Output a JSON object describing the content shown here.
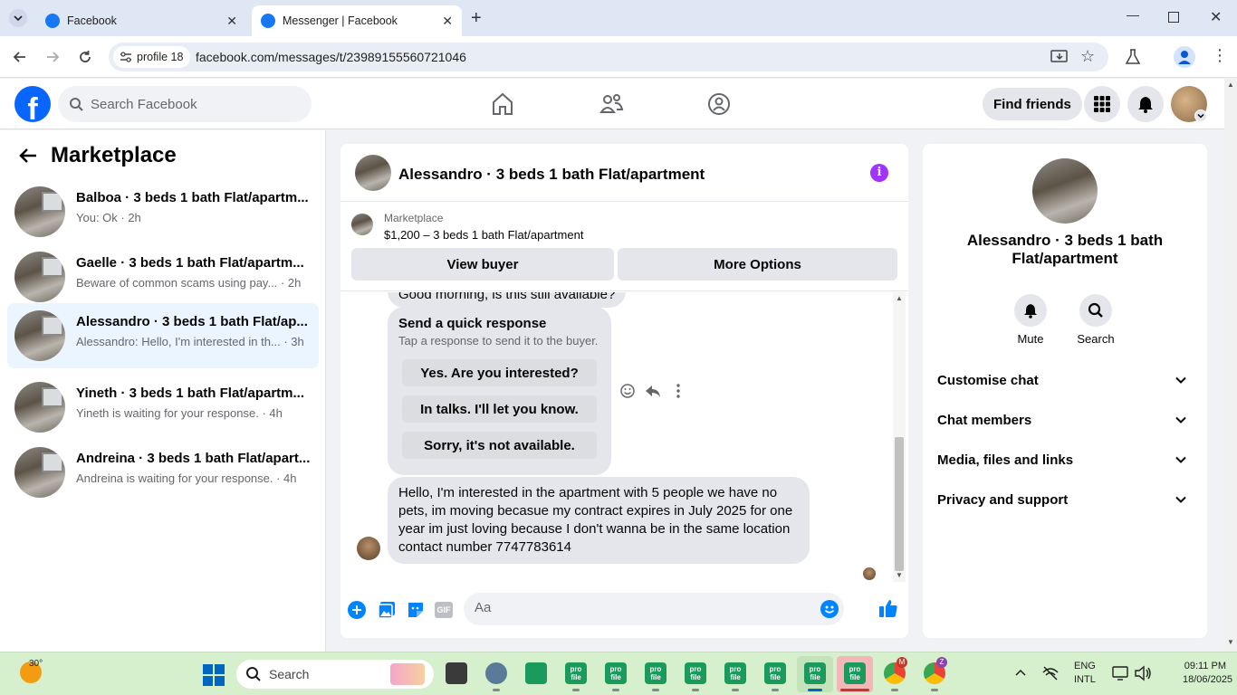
{
  "browser": {
    "tabs": [
      {
        "title": "Facebook"
      },
      {
        "title": "Messenger | Facebook"
      }
    ],
    "profile_chip": "profile 18",
    "url": "facebook.com/messages/t/23989155560721046"
  },
  "fb_header": {
    "logo": "f",
    "search_placeholder": "Search Facebook",
    "find_friends_label": "Find friends"
  },
  "marketplace": {
    "title": "Marketplace",
    "conversations": [
      {
        "name": "Balboa · 3 beds 1 bath Flat/apartm...",
        "preview": "You: Ok · 2h"
      },
      {
        "name": "Gaelle · 3 beds 1 bath Flat/apartm...",
        "preview": "Beware of common scams using pay... · 2h"
      },
      {
        "name": "Alessandro · 3 beds 1 bath Flat/ap...",
        "preview": "Alessandro: Hello, I'm interested in th... · 3h"
      },
      {
        "name": "Yineth · 3 beds 1 bath Flat/apartm...",
        "preview": "Yineth is waiting for your response. · 4h"
      },
      {
        "name": "Andreina · 3 beds 1 bath Flat/apart...",
        "preview": "Andreina is waiting for your response. · 4h"
      }
    ]
  },
  "chat": {
    "title": "Alessandro · 3 beds 1 bath Flat/apartment",
    "info_icon": "i",
    "listing": {
      "label": "Marketplace",
      "price_title": "$1,200 – 3 beds 1 bath Flat/apartment",
      "view_buyer": "View buyer",
      "more_options": "More Options"
    },
    "partial_message": "Good morning, is this still available?",
    "quick_response": {
      "title": "Send a quick response",
      "subtitle": "Tap a response to send it to the buyer.",
      "options": [
        "Yes. Are you interested?",
        "In talks. I'll let you know.",
        "Sorry, it's not available."
      ]
    },
    "message": "Hello, I'm interested in the apartment with 5 people we have no pets, im moving becasue my contract expires in July 2025 for one year im just loving because I don't wanna be in the same location contact number 7747783614",
    "composer_placeholder": "Aa"
  },
  "info_panel": {
    "name": "Alessandro · 3 beds 1 bath Flat/apartment",
    "mute_label": "Mute",
    "search_label": "Search",
    "sections": [
      "Customise chat",
      "Chat members",
      "Media, files and links",
      "Privacy and support"
    ]
  },
  "taskbar": {
    "weather_temp": "30°",
    "search_label": "Search",
    "lang_line1": "ENG",
    "lang_line2": "INTL",
    "time": "09:11 PM",
    "date": "18/06/2025",
    "app_label": "pro file",
    "badge_m": "M",
    "badge_z": "Z"
  },
  "colors": {
    "fb_blue": "#0866ff",
    "messenger_blue": "#0084ff",
    "info_purple": "#a033ff",
    "active_conv_bg": "#ebf5ff",
    "taskbar_bg": "#d6efcd"
  }
}
